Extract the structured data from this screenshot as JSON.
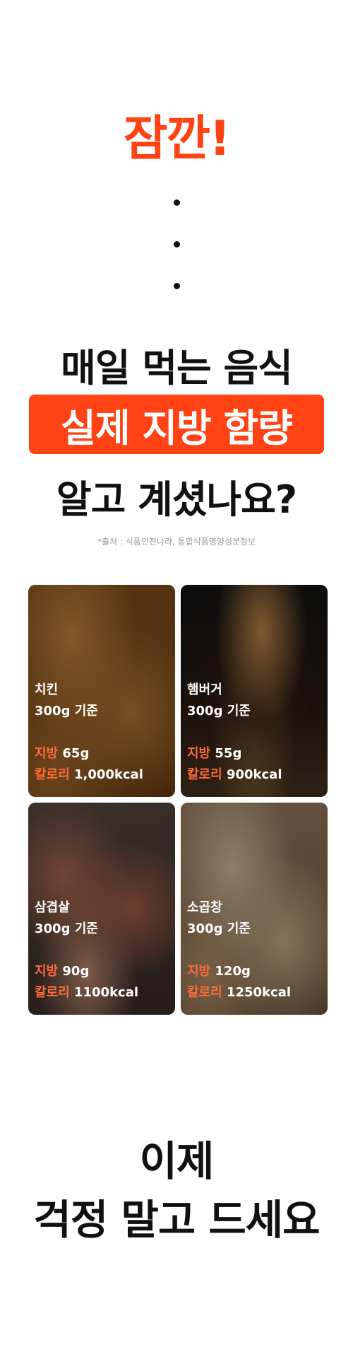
{
  "header": {
    "headline": "잠깐!",
    "dot_icons": [
      "dot-icon",
      "dot-icon",
      "dot-icon"
    ]
  },
  "question": {
    "line1": "매일 먹는 음식",
    "banner": "실제 지방 함량",
    "line3": "알고 계셨나요?"
  },
  "source_note": "*출처 : 식품안전나라, 통합식품영양성분정보",
  "cards": [
    {
      "name": "치킨",
      "basis": "300g 기준",
      "fat_label": "지방",
      "fat_value": "65g",
      "cal_label": "칼로리",
      "cal_value": "1,000kcal"
    },
    {
      "name": "햄버거",
      "basis": "300g 기준",
      "fat_label": "지방",
      "fat_value": "55g",
      "cal_label": "칼로리",
      "cal_value": "900kcal"
    },
    {
      "name": "삼겹살",
      "basis": "300g 기준",
      "fat_label": "지방",
      "fat_value": "90g",
      "cal_label": "칼로리",
      "cal_value": "1100kcal"
    },
    {
      "name": "소곱창",
      "basis": "300g 기준",
      "fat_label": "지방",
      "fat_value": "120g",
      "cal_label": "칼로리",
      "cal_value": "1250kcal"
    }
  ],
  "closing": {
    "line1": "이제",
    "line2": "걱정 말고 드세요"
  },
  "colors": {
    "accent": "#ff4314",
    "label_accent": "#ff6a3c",
    "text": "#111111",
    "note": "#9a9a9a"
  }
}
